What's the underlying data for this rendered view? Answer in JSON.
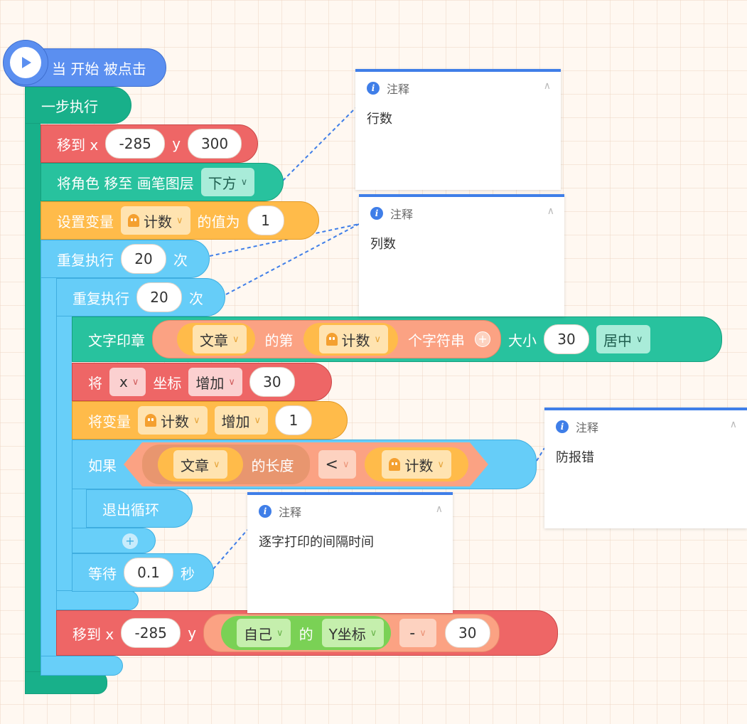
{
  "hat": {
    "label": "当 开始 被点击",
    "icon": "play-icon"
  },
  "step": {
    "label": "一步执行"
  },
  "move1": {
    "label": "移到 x",
    "x": "-285",
    "ylabel": "y",
    "y": "300"
  },
  "layer": {
    "label": "将角色 移至 画笔图层",
    "option": "下方"
  },
  "setvar": {
    "label": "设置变量",
    "var": "计数",
    "mid": "的值为",
    "value": "1"
  },
  "repeat1": {
    "label": "重复执行",
    "count": "20",
    "suffix": "次"
  },
  "repeat2": {
    "label": "重复执行",
    "count": "20",
    "suffix": "次"
  },
  "stamp": {
    "label": "文字印章",
    "text_var": "文章",
    "mid": "的第",
    "index_var": "计数",
    "suffix": "个字符串",
    "size_label": "大小",
    "size": "30",
    "align": "居中"
  },
  "changex": {
    "label": "将",
    "axis": "x",
    "mid": "坐标",
    "op": "增加",
    "value": "30"
  },
  "changevar": {
    "label": "将变量",
    "var": "计数",
    "op": "增加",
    "value": "1"
  },
  "ifblock": {
    "label": "如果",
    "text_var": "文章",
    "length": "的长度",
    "cmp": "<",
    "var": "计数"
  },
  "breakloop": {
    "label": "退出循环"
  },
  "wait": {
    "label": "等待",
    "value": "0.1",
    "suffix": "秒"
  },
  "move2": {
    "label": "移到 x",
    "x": "-285",
    "ylabel": "y",
    "self": "自己",
    "of": "的",
    "prop": "Y坐标",
    "op": "-",
    "value": "30"
  },
  "notes": [
    {
      "title": "注释",
      "text": "行数"
    },
    {
      "title": "注释",
      "text": "列数"
    },
    {
      "title": "注释",
      "text": "防报错"
    },
    {
      "title": "注释",
      "text": "逐字打印的间隔时间"
    }
  ],
  "colors": {
    "event": "#5b8ff0",
    "motion": "#ee6666",
    "looks": "#28c29e",
    "variables": "#ffbb4a",
    "control": "#66cdf8",
    "operators": "#fba283",
    "sensing": "#7ad155",
    "comment_accent": "#3f7ee8"
  }
}
